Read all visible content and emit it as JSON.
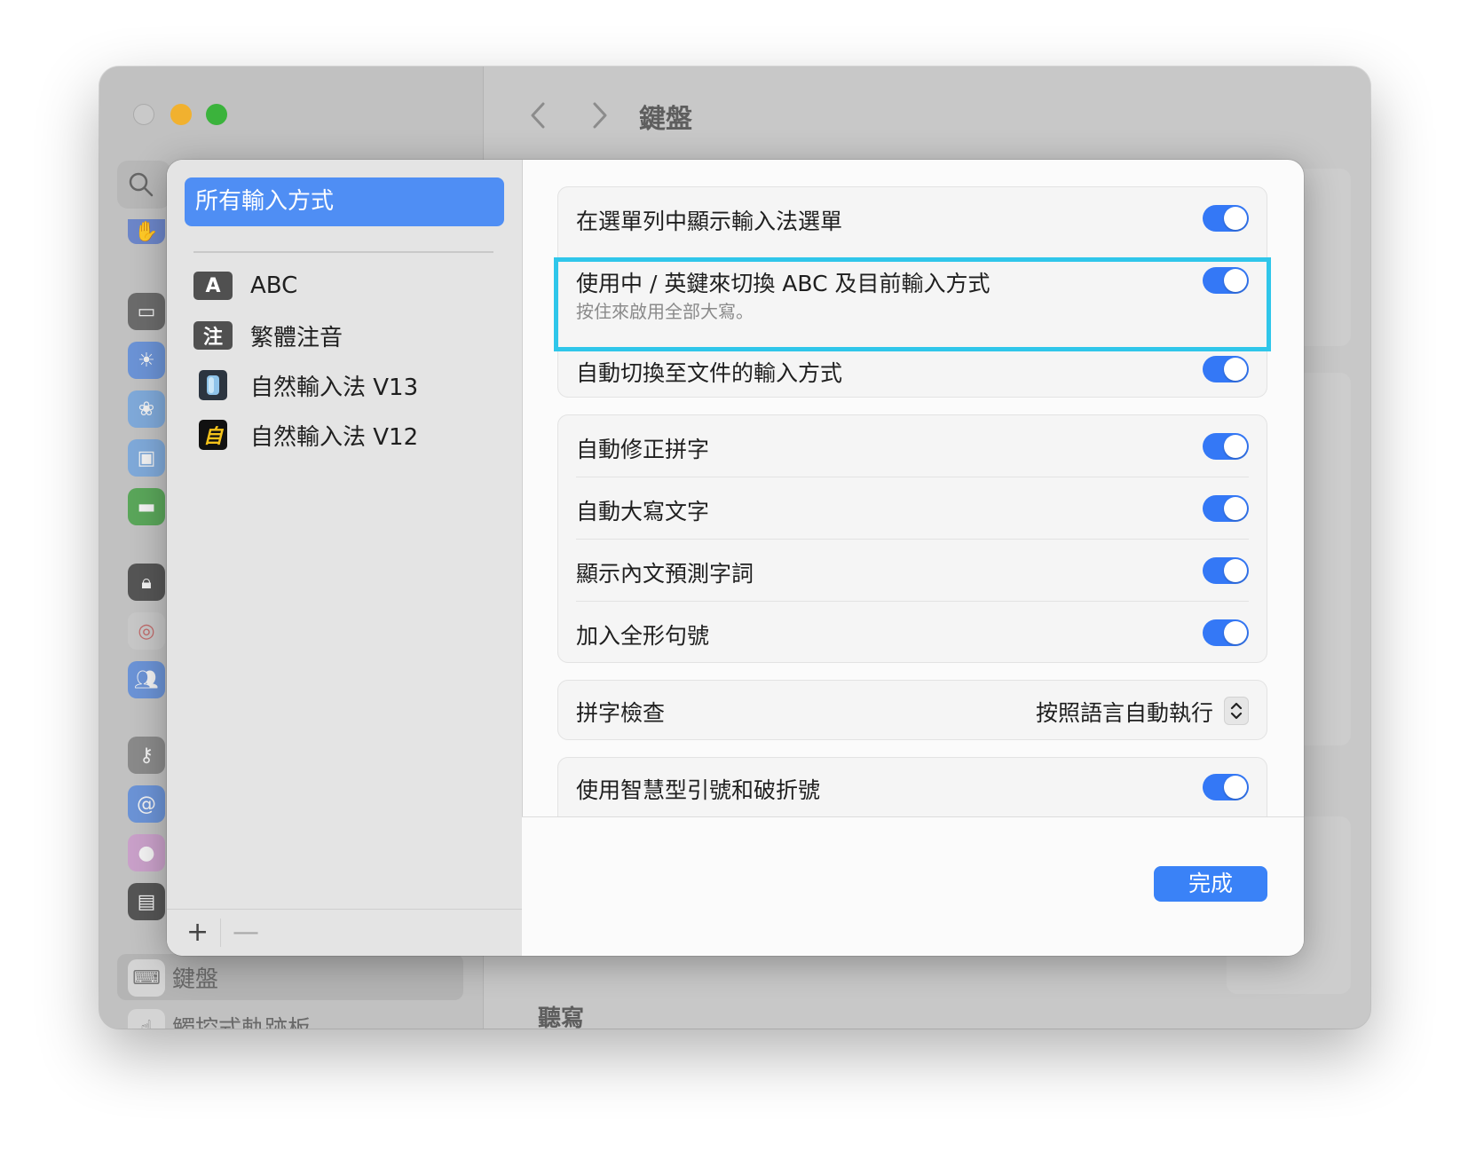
{
  "window": {
    "title": "鍵盤",
    "sidebar_selected_label": "鍵盤",
    "sidebar_next_label": "觸控式軌跡板",
    "main_section_label": "聽寫"
  },
  "sheet": {
    "sidebar": {
      "all_methods_label": "所有輸入方式",
      "methods": [
        {
          "badge": "A",
          "label": "ABC"
        },
        {
          "badge": "注",
          "label": "繁體注音"
        },
        {
          "badge": "",
          "label": "自然輸入法 V13"
        },
        {
          "badge": "自",
          "label": "自然輸入法 V12"
        }
      ],
      "add_label": "+",
      "remove_label": "—"
    },
    "settings": {
      "show_menu": {
        "label": "在選單列中顯示輸入法選單",
        "on": true
      },
      "caps_switch": {
        "label": "使用中 / 英鍵來切換 ABC 及目前輸入方式",
        "sublabel": "按住來啟用全部大寫。",
        "on": true
      },
      "auto_switch": {
        "label": "自動切換至文件的輸入方式",
        "on": true
      },
      "auto_correct": {
        "label": "自動修正拼字",
        "on": true
      },
      "auto_capitalize": {
        "label": "自動大寫文字",
        "on": true
      },
      "inline_predict": {
        "label": "顯示內文預測字詞",
        "on": true
      },
      "fullwidth_period": {
        "label": "加入全形句號",
        "on": true
      },
      "spell_check": {
        "label": "拼字檢查",
        "value": "按照語言自動執行"
      },
      "smart_quotes": {
        "label": "使用智慧型引號和破折號",
        "on": true
      }
    },
    "done_label": "完成"
  },
  "colors": {
    "accent": "#3478f6",
    "highlight_border": "#2fc6ea",
    "selection": "#4f8ef4"
  }
}
